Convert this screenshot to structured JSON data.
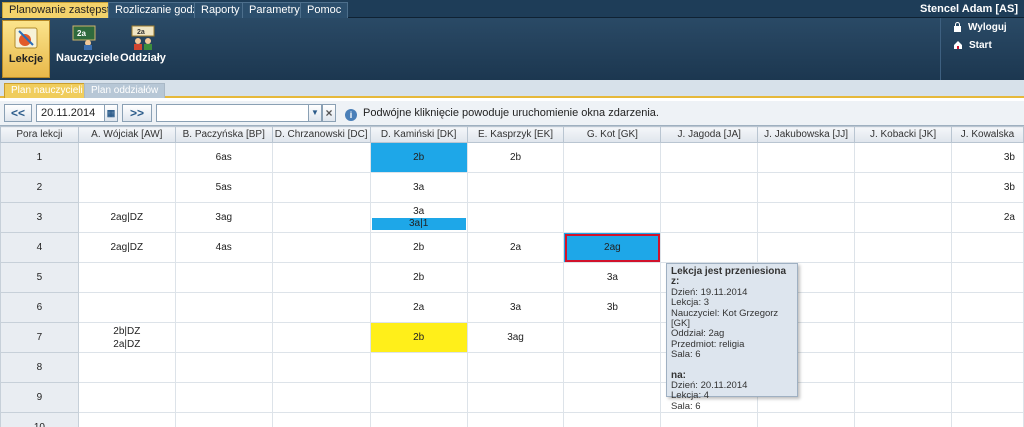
{
  "menu": {
    "items": [
      "Planowanie zastępstw",
      "Rozliczanie godzin",
      "Raporty",
      "Parametry",
      "Pomoc"
    ],
    "user": "Stencel Adam [AS]"
  },
  "toolbar": {
    "lessons": "Lekcje",
    "teachers": "Nauczyciele",
    "classes": "Oddziały",
    "logout": "Wyloguj",
    "start": "Start"
  },
  "subtabs": [
    "Plan nauczycieli",
    "Plan oddziałów"
  ],
  "controls": {
    "prev": "<<",
    "date": "20.11.2014",
    "next": ">>",
    "filter_value": "",
    "clear": "×",
    "hint": "Podwójne kliknięcie powoduje uruchomienie okna zdarzenia."
  },
  "grid": {
    "header_first": "Pora lekcji",
    "columns": [
      "A. Wójciak [AW]",
      "B. Paczyńska [BP]",
      "D. Chrzanowski [DC]",
      "D. Kamiński [DK]",
      "E. Kasprzyk [EK]",
      "G. Kot [GK]",
      "J. Jagoda [JA]",
      "J. Jakubowska [JJ]",
      "J. Kobacki [JK]",
      "J. Kowalska"
    ],
    "rows": [
      "1",
      "2",
      "3",
      "4",
      "5",
      "6",
      "7",
      "8",
      "9",
      "10"
    ],
    "cells": {
      "r1": {
        "c2": "6as",
        "c4": "2b",
        "c5": "2b",
        "c10": "3b"
      },
      "r2": {
        "c2": "5as",
        "c4": "3a",
        "c10": "3b"
      },
      "r3": {
        "c1": "2ag|DZ",
        "c2": "3ag",
        "c4_top": "3a",
        "c4_bar": "3a|1",
        "c10": "2a"
      },
      "r4": {
        "c1": "2ag|DZ",
        "c2": "4as",
        "c4": "2b",
        "c5": "2a",
        "c6": "2ag"
      },
      "r5": {
        "c4": "2b",
        "c6": "3a"
      },
      "r6": {
        "c4": "2a",
        "c5": "3a",
        "c6": "3b"
      },
      "r7": {
        "c1a": "2b|DZ",
        "c1b": "2a|DZ",
        "c4": "2b",
        "c5": "3ag"
      }
    }
  },
  "tooltip": {
    "title": "Lekcja jest przeniesiona z:",
    "from_day": "Dzień: 19.11.2014",
    "from_lesson": "Lekcja: 3",
    "teacher": "Nauczyciel: Kot Grzegorz [GK]",
    "class": "Oddział: 2ag",
    "subject": "Przedmiot: religia",
    "from_room": "Sala: 6",
    "to_title": "na:",
    "to_day": "Dzień: 20.11.2014",
    "to_lesson": "Lekcja: 4",
    "to_room": "Sala: 6"
  },
  "colors": {
    "accent": "#f3d36b",
    "highlight": "#1ea7e8",
    "yellow": "#ffef1a",
    "selected_border": "#d1122b"
  }
}
